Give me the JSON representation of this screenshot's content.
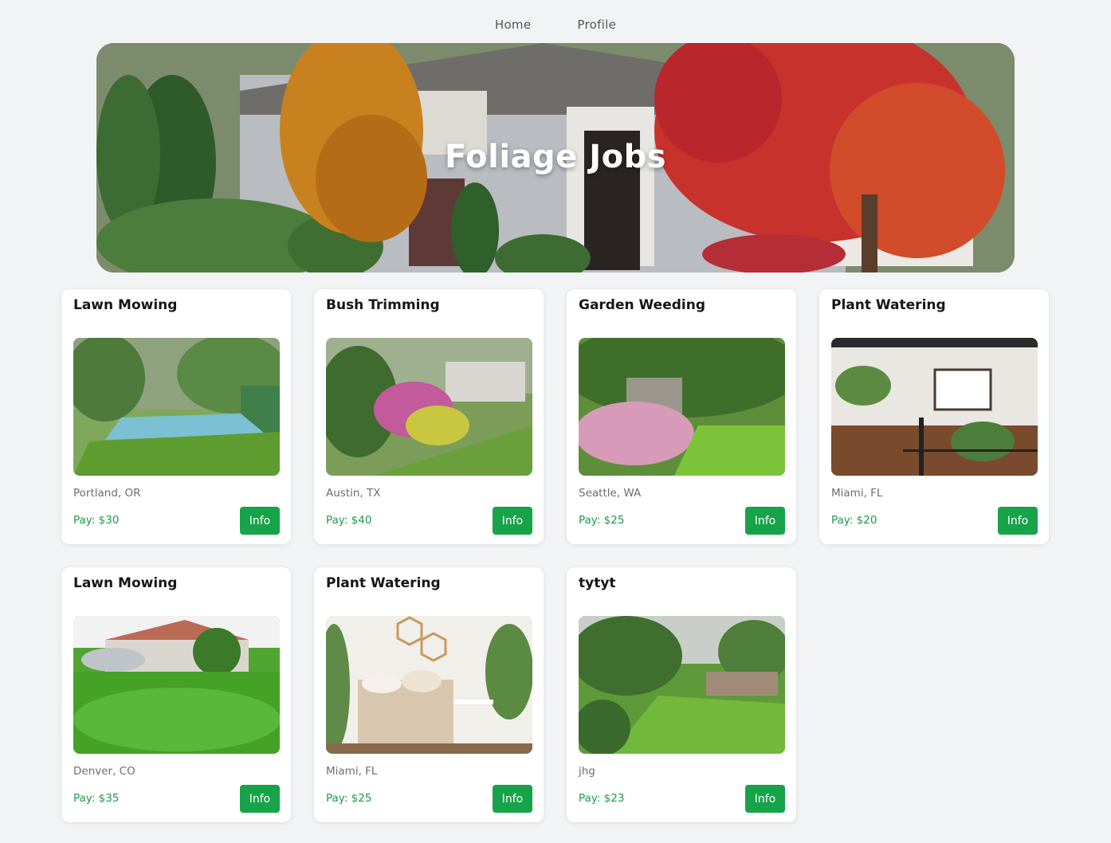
{
  "nav": {
    "home": "Home",
    "profile": "Profile"
  },
  "hero": {
    "title": "Foliage Jobs"
  },
  "button_label": "Info",
  "jobs": [
    {
      "title": "Lawn Mowing",
      "location": "Portland, OR",
      "pay": "Pay: $30"
    },
    {
      "title": "Bush Trimming",
      "location": "Austin, TX",
      "pay": "Pay: $40"
    },
    {
      "title": "Garden Weeding",
      "location": "Seattle, WA",
      "pay": "Pay: $25"
    },
    {
      "title": "Plant Watering",
      "location": "Miami, FL",
      "pay": "Pay: $20"
    },
    {
      "title": "Lawn Mowing",
      "location": "Denver, CO",
      "pay": "Pay: $35"
    },
    {
      "title": "Plant Watering",
      "location": "Miami, FL",
      "pay": "Pay: $25"
    },
    {
      "title": "tytyt",
      "location": "jhg",
      "pay": "Pay: $23"
    }
  ],
  "colors": {
    "accent": "#17a34a",
    "pay_text": "#1e9a4b",
    "background": "#f2f3f5"
  }
}
